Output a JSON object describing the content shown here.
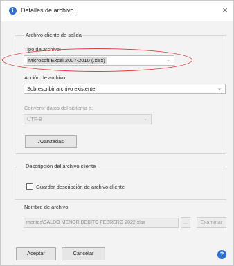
{
  "window": {
    "title": "Detalles de archivo",
    "close_glyph": "×",
    "app_icon": "info-icon"
  },
  "output_group": {
    "title": "Archivo cliente de salida",
    "file_type": {
      "label": "Tipo de archivo:",
      "value": "Microsoft Excel 2007-2010 (.xlsx)"
    },
    "file_action": {
      "label": "Acción de archivo:",
      "value": "Sobrescribir archivo existente"
    },
    "convert_data": {
      "label": "Convertir datos del sistema a:",
      "value": "UTF-8"
    },
    "advanced_button": "Avanzadas"
  },
  "description_group": {
    "title": "Descripción del archivo cliente",
    "save_checkbox_label": "Guardar descripción de archivo cliente",
    "save_checked": false
  },
  "file_name": {
    "label": "Nombre de archivo:",
    "value": "mentos\\SALDO MENOR DEBITO FEBRERO 2022.xlsx",
    "ellipsis_button": "...",
    "browse_button": "Examinar"
  },
  "footer": {
    "accept_button": "Aceptar",
    "cancel_button": "Cancelar",
    "help_icon": "help-icon"
  },
  "annotation": {
    "color": "#e0383e"
  }
}
